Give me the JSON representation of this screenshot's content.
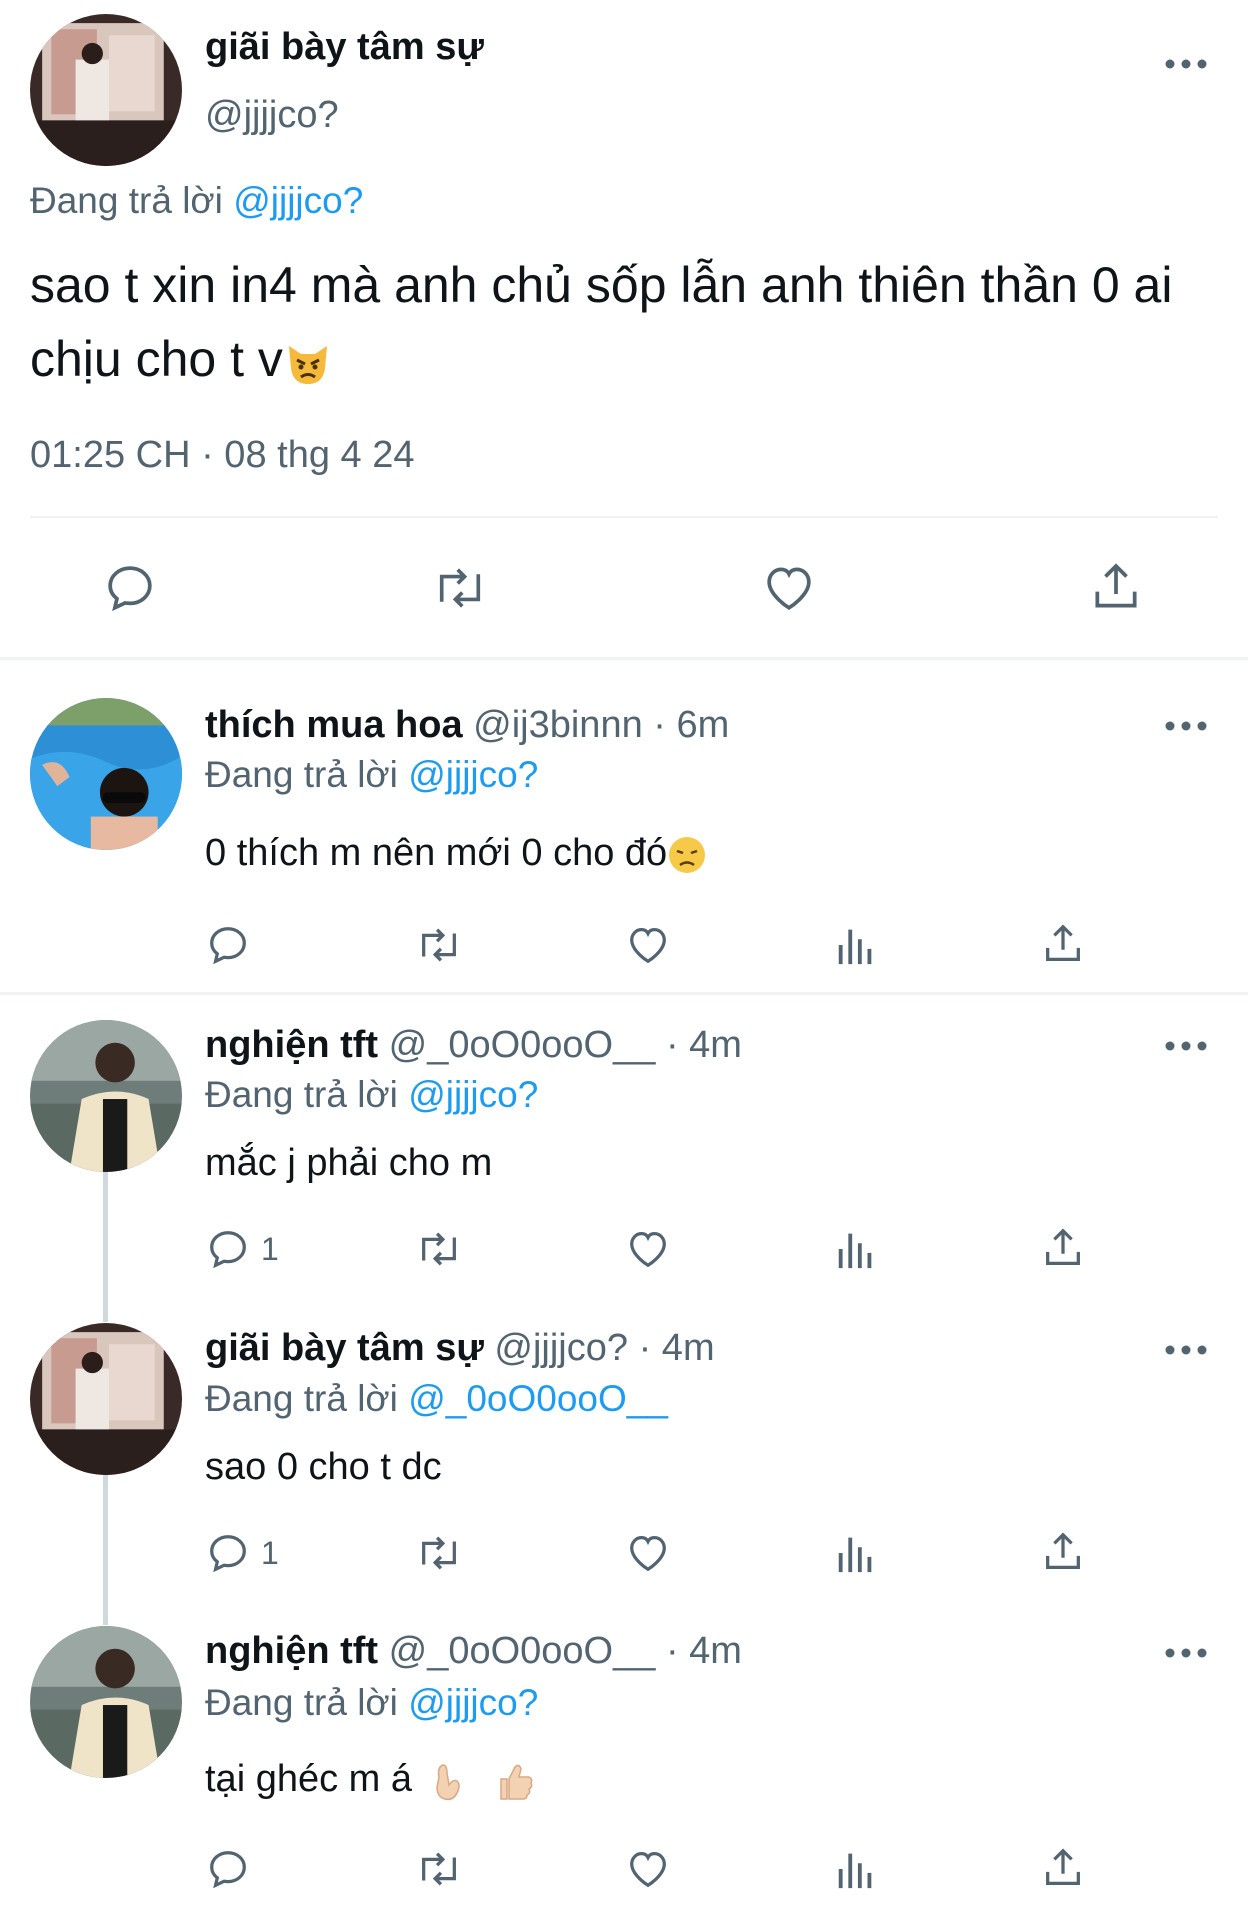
{
  "main_tweet": {
    "display_name": "giãi bày tâm sự",
    "handle": "@jjjjco?",
    "reply_prefix": "Đang trả lời",
    "reply_to": "@jjjjco?",
    "text": "sao t xin in4 mà anh chủ sốp lẫn anh thiên thần 0 ai chịu cho t v",
    "timestamp": "01:25 CH · 08 thg 4 24"
  },
  "replies": [
    {
      "display_name": "thích mua hoa",
      "handle": "@ij3binnn",
      "time": "· 6m",
      "reply_prefix": "Đang trả lời",
      "reply_to": "@jjjjco?",
      "text": "0 thích m nên mới 0 cho đó",
      "reply_count": ""
    },
    {
      "display_name": "nghiện tft",
      "handle": "@_0oO0ooO__",
      "time": "· 4m",
      "reply_prefix": "Đang trả lời",
      "reply_to": "@jjjjco?",
      "text": "mắc j phải cho m",
      "reply_count": "1"
    },
    {
      "display_name": "giãi bày tâm sự",
      "handle": "@jjjjco?",
      "time": "· 4m",
      "reply_prefix": "Đang trả lời",
      "reply_to": "@_0oO0ooO__",
      "text": "sao 0 cho t dc",
      "reply_count": "1"
    },
    {
      "display_name": "nghiện tft",
      "handle": "@_0oO0ooO__",
      "time": "· 4m",
      "reply_prefix": "Đang trả lời",
      "reply_to": "@jjjjco?",
      "text": "tại ghéc m á",
      "reply_count": ""
    }
  ],
  "icons": {
    "more": "more-horizontal-icon",
    "reply": "reply-bubble-icon",
    "retweet": "retweet-icon",
    "like": "heart-icon",
    "views": "analytics-bars-icon",
    "share": "share-upload-icon"
  },
  "colors": {
    "link": "#1d9bf0",
    "muted": "#536471",
    "text": "#0f1419",
    "divider": "#eff3f4"
  }
}
